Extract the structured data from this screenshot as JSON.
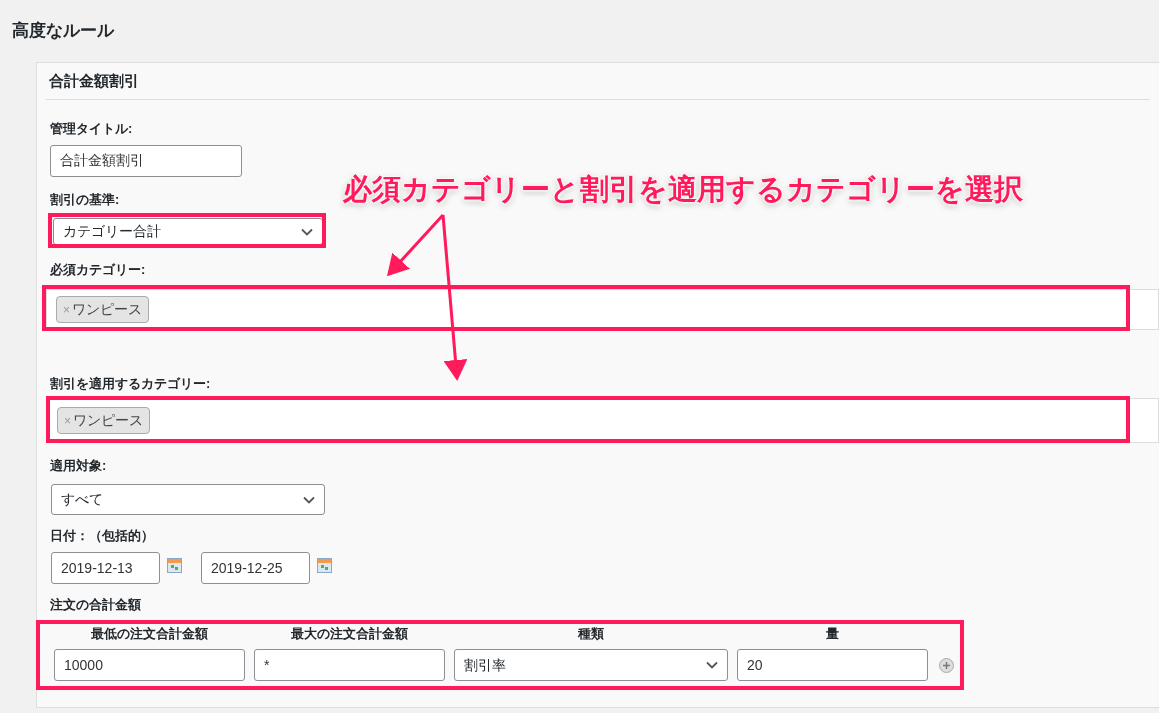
{
  "page_title": "高度なルール",
  "rule": {
    "title": "合計金額割引",
    "admin_title": {
      "label": "管理タイトル:",
      "value": "合計金額割引"
    },
    "discount_basis": {
      "label": "割引の基準:",
      "value": "カテゴリー合計"
    },
    "required_categories": {
      "label": "必須カテゴリー:",
      "tags": [
        "ワンピース"
      ]
    },
    "discount_categories": {
      "label": "割引を適用するカテゴリー:",
      "tags": [
        "ワンピース"
      ]
    },
    "apply_to": {
      "label": "適用対象:",
      "value": "すべて"
    },
    "dates": {
      "label": "日付：（包括的）",
      "from": "2019-12-13",
      "to": "2019-12-25"
    },
    "order_total": {
      "label": "注文の合計金額",
      "columns": [
        "最低の注文合計金額",
        "最大の注文合計金額",
        "種類",
        "量"
      ],
      "rows": [
        {
          "min": "10000",
          "max": "*",
          "type": "割引率",
          "amount": "20"
        }
      ]
    }
  },
  "annotation": {
    "text": "必須カテゴリーと割引を適用するカテゴリーを選択"
  },
  "tag_remove_symbol": "×"
}
